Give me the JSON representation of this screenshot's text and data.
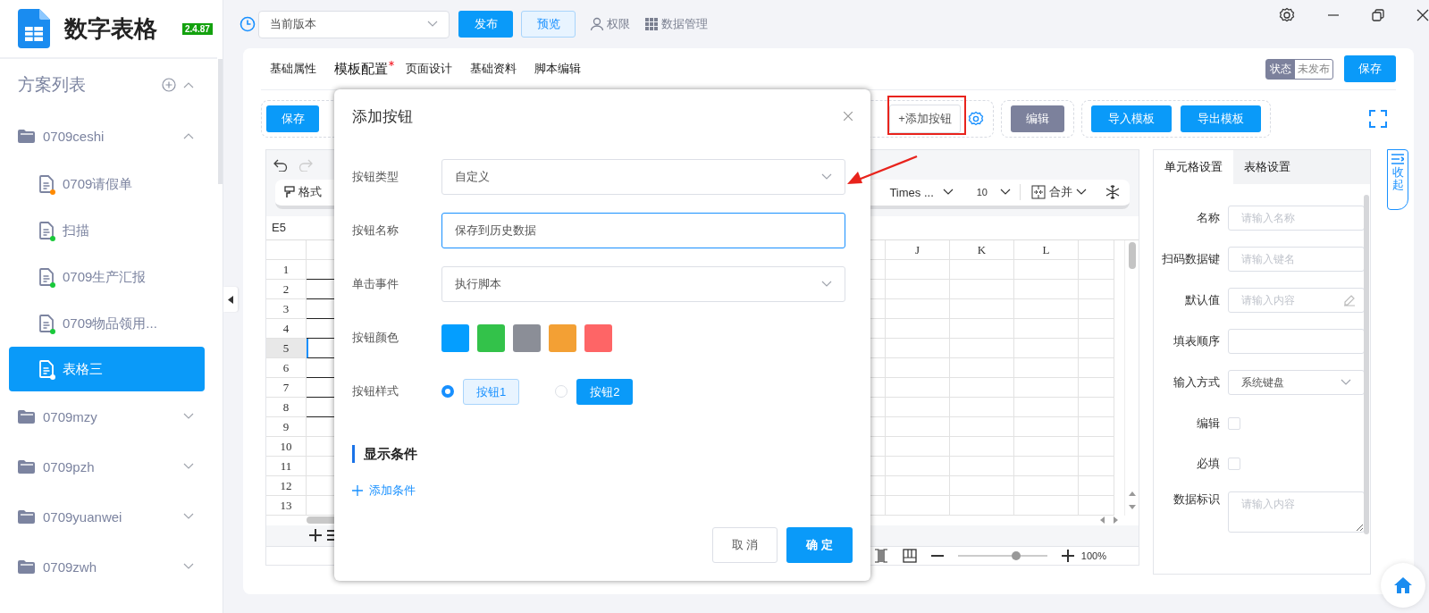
{
  "app": {
    "title": "数字表格",
    "version": "2.4.87"
  },
  "sidebar": {
    "title": "方案列表",
    "groups": [
      {
        "name": "0709ceshi",
        "expanded": true,
        "children": [
          {
            "name": "0709请假单",
            "color": "#ff8a00",
            "selected": false
          },
          {
            "name": "扫描",
            "color": "#19c93a",
            "selected": false
          },
          {
            "name": "0709生产汇报",
            "color": "#19c93a",
            "selected": false
          },
          {
            "name": "0709物品领用...",
            "color": "#19c93a",
            "selected": false
          },
          {
            "name": "表格三",
            "color": "#ffffff",
            "selected": true
          }
        ]
      },
      {
        "name": "0709mzy",
        "expanded": false
      },
      {
        "name": "0709pzh",
        "expanded": false
      },
      {
        "name": "0709yuanwei",
        "expanded": false
      },
      {
        "name": "0709zwh",
        "expanded": false
      }
    ]
  },
  "topbar": {
    "version_select": "当前版本",
    "publish": "发布",
    "preview": "预览",
    "links": [
      "权限",
      "数据管理"
    ]
  },
  "tabs": [
    {
      "label": "基础属性",
      "selected": false,
      "required": false
    },
    {
      "label": "模板配置",
      "selected": true,
      "required": true
    },
    {
      "label": "页面设计",
      "selected": false,
      "required": false
    },
    {
      "label": "基础资料",
      "selected": false,
      "required": false
    },
    {
      "label": "脚本编辑",
      "selected": false,
      "required": false
    }
  ],
  "status": {
    "label": "状态",
    "value": "未发布"
  },
  "save": "保存",
  "toolbar": {
    "save": "保存",
    "add_button": "+添加按钮",
    "edit": "编辑",
    "import": "导入模板",
    "export": "导出模板"
  },
  "sheet": {
    "format_painter": "格式",
    "font": "Times ...",
    "font_size": "10",
    "merge": "合并",
    "cell_ref": "E5",
    "column_headers": [
      "J",
      "K",
      "L"
    ],
    "rows": [
      {
        "label": "1",
        "selected": false,
        "boxed": true
      },
      {
        "label": "2",
        "selected": false,
        "boxed": true
      },
      {
        "label": "3",
        "selected": false,
        "boxed": true
      },
      {
        "label": "4",
        "selected": false,
        "boxed": true
      },
      {
        "label": "5",
        "selected": true,
        "boxed": true
      },
      {
        "label": "6",
        "selected": false,
        "boxed": true
      },
      {
        "label": "7",
        "selected": false,
        "boxed": true
      },
      {
        "label": "8",
        "selected": false,
        "boxed": true
      },
      {
        "label": "9",
        "selected": false,
        "boxed": false
      },
      {
        "label": "10",
        "selected": false,
        "boxed": false
      },
      {
        "label": "11",
        "selected": false,
        "boxed": false
      },
      {
        "label": "12",
        "selected": false,
        "boxed": false
      },
      {
        "label": "13",
        "selected": false,
        "boxed": false
      }
    ],
    "zoom": {
      "level": 0.65,
      "reading": "100%"
    }
  },
  "panel": {
    "tabs": [
      {
        "label": "单元格设置",
        "selected": true
      },
      {
        "label": "表格设置",
        "selected": false
      }
    ],
    "fields": [
      {
        "kind": "input",
        "label": "名称",
        "placeholder": "请输入名称"
      },
      {
        "kind": "input",
        "label": "扫码数据键",
        "placeholder": "请输入键名"
      },
      {
        "kind": "edit",
        "label": "默认值",
        "placeholder": "请输入内容"
      },
      {
        "kind": "input",
        "label": "填表顺序"
      },
      {
        "kind": "select",
        "label": "输入方式",
        "value": "系统键盘"
      },
      {
        "kind": "checkbox",
        "label": "编辑",
        "checked": false
      },
      {
        "kind": "checkbox",
        "label": "必填",
        "checked": false
      },
      {
        "kind": "textarea",
        "label": "数据标识",
        "placeholder": "请输入内容"
      }
    ],
    "collapse": "收起"
  },
  "dialog": {
    "title": "添加按钮",
    "fields": [
      {
        "kind": "select",
        "label": "按钮类型",
        "value": "自定义"
      },
      {
        "kind": "input",
        "label": "按钮名称",
        "value": "保存到历史数据"
      },
      {
        "kind": "select",
        "label": "单击事件",
        "value": "执行脚本"
      },
      {
        "kind": "colors",
        "label": "按钮颜色",
        "colors": [
          {
            "color": "#049eff"
          },
          {
            "color": "#33c24a"
          },
          {
            "color": "#8b8e97"
          },
          {
            "color": "#f3a034"
          },
          {
            "color": "#fe6566"
          }
        ]
      },
      {
        "kind": "radios",
        "label": "按钮样式",
        "options": [
          {
            "label": "按钮1",
            "selected": true
          },
          {
            "label": "按钮2",
            "selected": false
          }
        ]
      }
    ],
    "section": "显示条件",
    "add_condition": "添加条件",
    "cancel": "取 消",
    "ok": "确 定"
  }
}
